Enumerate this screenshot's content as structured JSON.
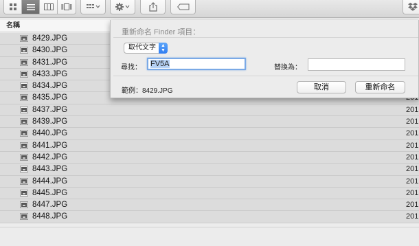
{
  "header": {
    "name_col": "名稱",
    "date_col": "日"
  },
  "files": [
    {
      "name": "8429.JPG",
      "date": ""
    },
    {
      "name": "8430.JPG",
      "date": ""
    },
    {
      "name": "8431.JPG",
      "date": ""
    },
    {
      "name": "8433.JPG",
      "date": ""
    },
    {
      "name": "8434.JPG",
      "date": ""
    },
    {
      "name": "8435.JPG",
      "date": "201"
    },
    {
      "name": "8437.JPG",
      "date": "201"
    },
    {
      "name": "8439.JPG",
      "date": "201"
    },
    {
      "name": "8440.JPG",
      "date": "201"
    },
    {
      "name": "8441.JPG",
      "date": "201"
    },
    {
      "name": "8442.JPG",
      "date": "201"
    },
    {
      "name": "8443.JPG",
      "date": "201"
    },
    {
      "name": "8444.JPG",
      "date": "201"
    },
    {
      "name": "8445.JPG",
      "date": "201"
    },
    {
      "name": "8447.JPG",
      "date": "201"
    },
    {
      "name": "8448.JPG",
      "date": "201"
    }
  ],
  "sheet": {
    "title": "重新命名 Finder 項目：",
    "mode": "取代文字",
    "find_label": "尋找：",
    "find_value": "FV5A",
    "replace_label": "替換為：",
    "replace_value": "",
    "example_label": "範例：8429.JPG",
    "cancel": "取消",
    "rename": "重新命名"
  },
  "icons": {
    "view_icon": "icon-view",
    "list_view": "list-view",
    "column_view": "column-view",
    "coverflow_view": "coverflow-view",
    "arrange": "arrange",
    "action": "gear",
    "share": "share",
    "tags": "tag",
    "dropbox": "dropbox"
  }
}
